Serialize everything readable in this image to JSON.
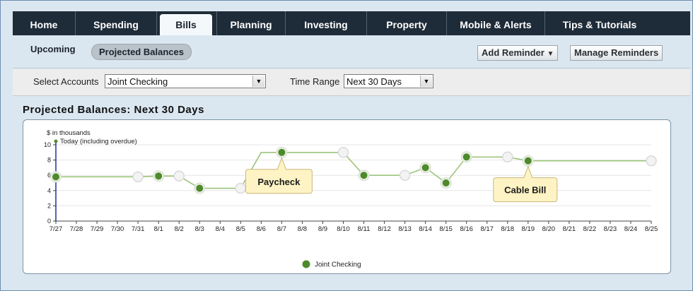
{
  "nav": {
    "tabs": [
      {
        "label": "Home"
      },
      {
        "label": "Spending"
      },
      {
        "label": "Bills",
        "active": true
      },
      {
        "label": "Planning"
      },
      {
        "label": "Investing"
      },
      {
        "label": "Property"
      },
      {
        "label": "Mobile & Alerts"
      },
      {
        "label": "Tips & Tutorials"
      }
    ]
  },
  "subnav": {
    "upcoming": "Upcoming",
    "projected": "Projected Balances",
    "add_reminder": "Add Reminder",
    "manage_reminders": "Manage Reminders"
  },
  "filters": {
    "accounts_label": "Select Accounts",
    "accounts_value": "Joint Checking",
    "range_label": "Time Range",
    "range_value": "Next 30 Days"
  },
  "panel": {
    "title": "Projected Balances: Next 30 Days"
  },
  "chart_data": {
    "type": "line",
    "ylabel": "$ in thousands",
    "ylim": [
      0,
      10
    ],
    "yticks": [
      0,
      2,
      4,
      6,
      8,
      10
    ],
    "today_label": "Today (including overdue)",
    "categories": [
      "7/27",
      "7/28",
      "7/29",
      "7/30",
      "7/31",
      "8/1",
      "8/2",
      "8/3",
      "8/4",
      "8/5",
      "8/6",
      "8/7",
      "8/8",
      "8/9",
      "8/10",
      "8/11",
      "8/12",
      "8/13",
      "8/14",
      "8/15",
      "8/16",
      "8/17",
      "8/18",
      "8/19",
      "8/20",
      "8/21",
      "8/22",
      "8/23",
      "8/24",
      "8/25"
    ],
    "series": [
      {
        "name": "Joint Checking",
        "color": "#4e8a2c",
        "line_color": "#9cc47a",
        "values": [
          5.8,
          5.8,
          5.8,
          5.8,
          5.8,
          5.9,
          5.9,
          4.3,
          4.3,
          4.3,
          9.0,
          9.0,
          9.0,
          9.0,
          9.0,
          6.0,
          6.0,
          6.0,
          7.0,
          5.0,
          8.4,
          8.4,
          8.4,
          7.9,
          7.9,
          7.9,
          7.9,
          7.9,
          7.9,
          7.9
        ],
        "markers": [
          {
            "i": 0,
            "kind": "event"
          },
          {
            "i": 4,
            "kind": "hollow"
          },
          {
            "i": 5,
            "kind": "event"
          },
          {
            "i": 6,
            "kind": "hollow"
          },
          {
            "i": 7,
            "kind": "event"
          },
          {
            "i": 9,
            "kind": "hollow"
          },
          {
            "i": 11,
            "kind": "event"
          },
          {
            "i": 14,
            "kind": "hollow"
          },
          {
            "i": 15,
            "kind": "event"
          },
          {
            "i": 17,
            "kind": "hollow"
          },
          {
            "i": 18,
            "kind": "event"
          },
          {
            "i": 19,
            "kind": "event"
          },
          {
            "i": 20,
            "kind": "event"
          },
          {
            "i": 22,
            "kind": "hollow"
          },
          {
            "i": 23,
            "kind": "event"
          },
          {
            "i": 29,
            "kind": "hollow"
          }
        ]
      }
    ],
    "callouts": [
      {
        "label": "Paycheck",
        "i": 11
      },
      {
        "label": "Cable Bill",
        "i": 23
      }
    ]
  }
}
